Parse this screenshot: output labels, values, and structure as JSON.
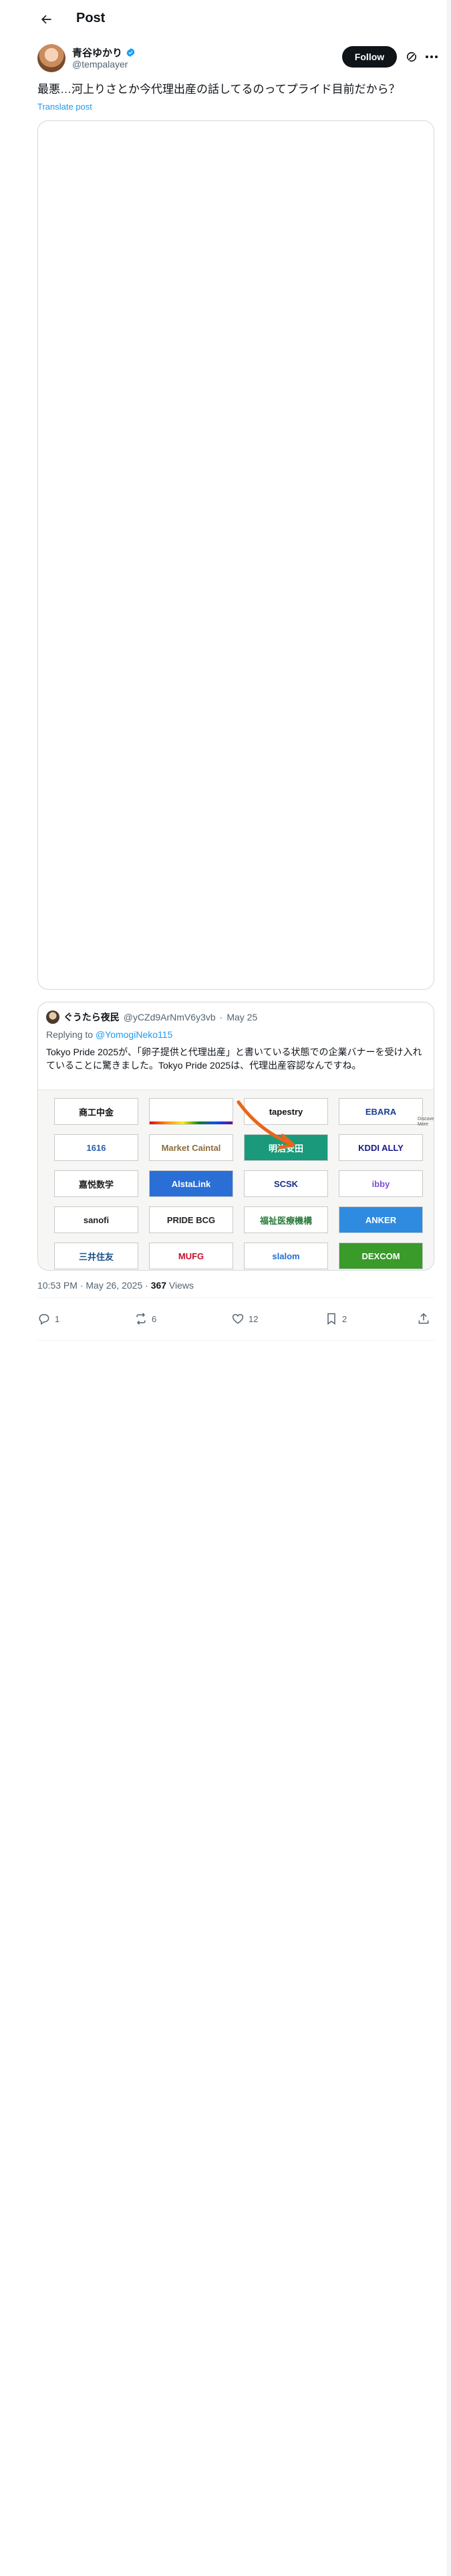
{
  "header": {
    "title": "Post"
  },
  "author": {
    "display_name": "青谷ゆかり",
    "handle": "@tempalayer",
    "follow_label": "Follow"
  },
  "post": {
    "text": "最悪…河上りさとか今代理出産の話してるのってプライド目前だから？",
    "translate_label": "Translate post"
  },
  "quote": {
    "display_name": "ぐうたら夜民",
    "handle": "@yCZd9ArNmV6y3vb",
    "separator": "·",
    "date": "May 25",
    "reply_prefix": "Replying to ",
    "reply_to": "@YomogiNeko115",
    "text": "Tokyo Pride 2025が、「卵子提供と代理出産」と書いている状態での企業バナーを受け入れていることに驚きました。Tokyo Pride 2025は、代理出産容認なんですね。",
    "side_text": "Discover More",
    "logos": [
      {
        "label": "商工中金",
        "bg": "#ffffff",
        "fg": "#111111"
      },
      {
        "label": "",
        "bg": "#ffffff",
        "fg": "#111111",
        "rainbow": true
      },
      {
        "label": "tapestry",
        "bg": "#ffffff",
        "fg": "#111111"
      },
      {
        "label": "EBARA",
        "bg": "#ffffff",
        "fg": "#1b3f8f"
      },
      {
        "label": "1616",
        "bg": "#ffffff",
        "fg": "#2a5fa8"
      },
      {
        "label": "Market Caintal",
        "bg": "#ffffff",
        "fg": "#8a6d3b"
      },
      {
        "label": "明治安田",
        "bg": "#1a9a7a",
        "fg": "#ffffff"
      },
      {
        "label": "KDDI ALLY",
        "bg": "#ffffff",
        "fg": "#1a1a8a"
      },
      {
        "label": "嘉悦数学",
        "bg": "#ffffff",
        "fg": "#222222"
      },
      {
        "label": "AlstaLink",
        "bg": "#2a6fd6",
        "fg": "#ffffff"
      },
      {
        "label": "SCSK",
        "bg": "#ffffff",
        "fg": "#1a2f8a"
      },
      {
        "label": "ibby",
        "bg": "#ffffff",
        "fg": "#7a4fd6"
      },
      {
        "label": "sanofi",
        "bg": "#ffffff",
        "fg": "#222222"
      },
      {
        "label": "PRIDE BCG",
        "bg": "#ffffff",
        "fg": "#222222"
      },
      {
        "label": "福祉医療機構",
        "bg": "#ffffff",
        "fg": "#2a7a3a"
      },
      {
        "label": "ANKER",
        "bg": "#2f8be0",
        "fg": "#ffffff"
      },
      {
        "label": "三井住友",
        "bg": "#ffffff",
        "fg": "#1a4f8a"
      },
      {
        "label": "MUFG",
        "bg": "#ffffff",
        "fg": "#c8102e"
      },
      {
        "label": "slalom",
        "bg": "#ffffff",
        "fg": "#1a6fd6"
      },
      {
        "label": "DEXCOM",
        "bg": "#3a9a2a",
        "fg": "#ffffff"
      }
    ]
  },
  "meta": {
    "time": "10:53 PM",
    "separator": " · ",
    "date": "May 26, 2025",
    "separator2": " · ",
    "views_count": "367",
    "views_label": " Views"
  },
  "actions": {
    "replies": "1",
    "reposts": "6",
    "likes": "12",
    "bookmarks": "2"
  },
  "colors": {
    "accent": "#1d9bf0",
    "text": "#0f1419",
    "muted": "#536471",
    "arrow": "#e8661a"
  }
}
